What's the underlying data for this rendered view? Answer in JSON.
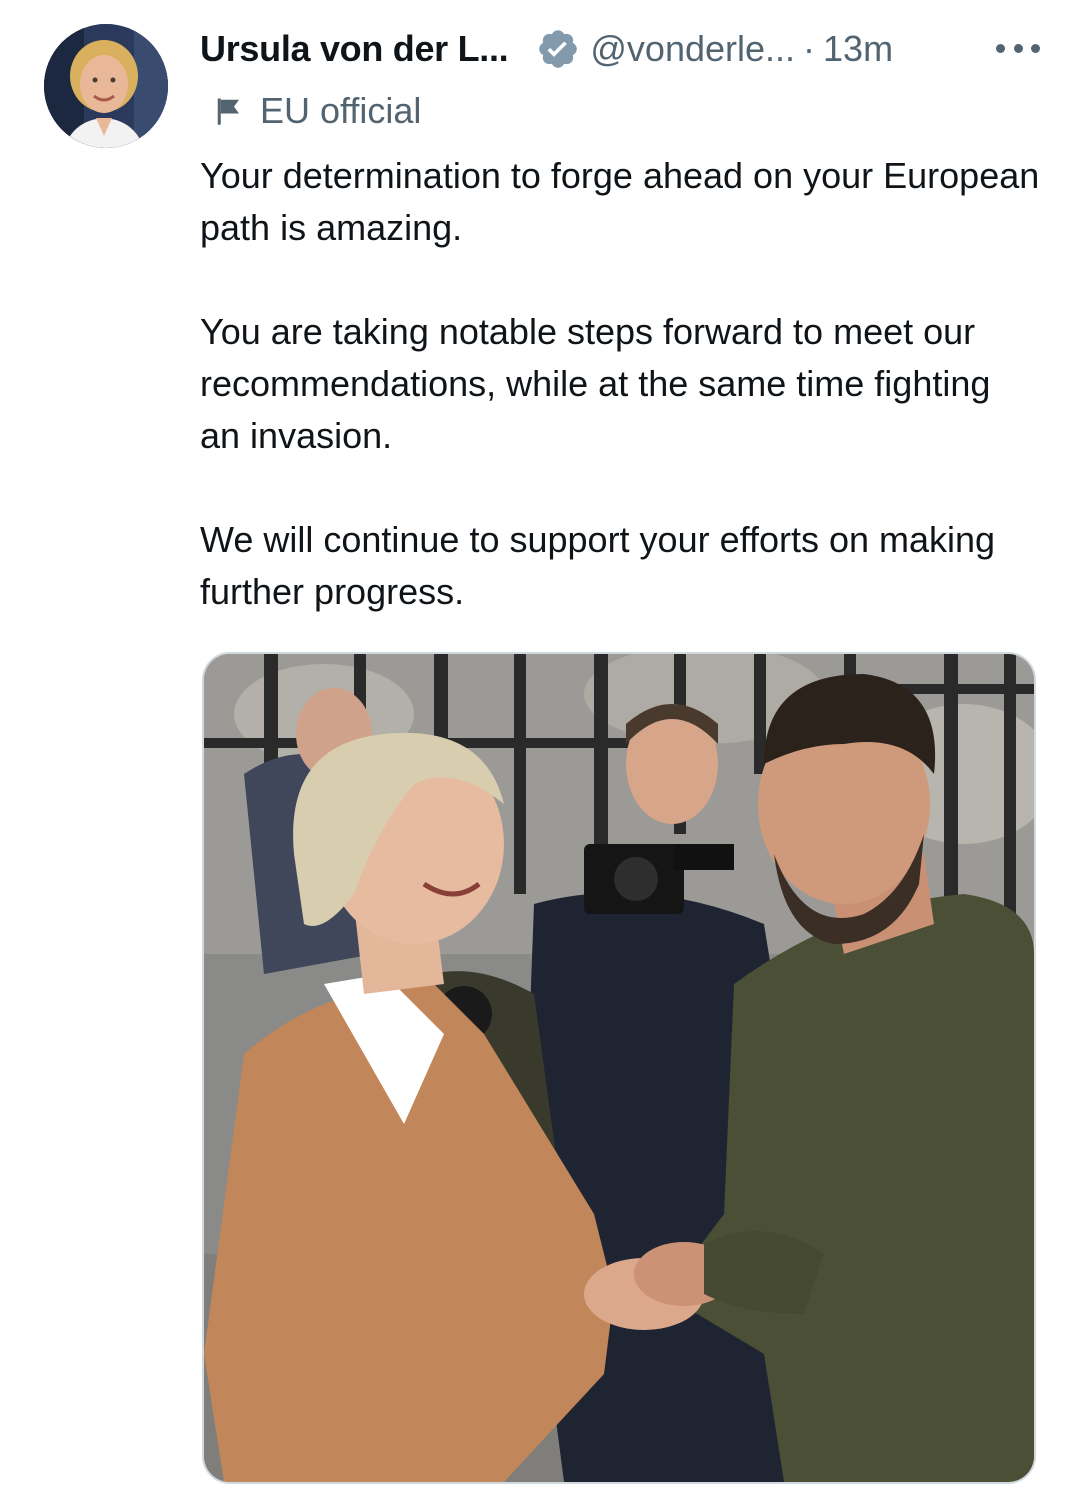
{
  "tweet": {
    "author": {
      "display_name": "Ursula von der L...",
      "handle": "@vonderle...",
      "verified": true,
      "avatar_icon": "profile-photo"
    },
    "separator": "·",
    "time": "13m",
    "more_icon": "more-horizontal-icon",
    "label": {
      "icon": "flag-icon",
      "text": "EU official"
    },
    "paragraphs": [
      "Your determination to forge ahead on your European path is amazing.",
      "You are taking notable steps forward to meet our recommendations, while at the same time fighting an invasion.",
      "We will continue to support your efforts on making further progress."
    ],
    "media": {
      "type": "photo"
    }
  },
  "colors": {
    "text_primary": "#0f1419",
    "text_secondary": "#536471",
    "verified_badge": "#829aab",
    "media_border": "#cfd9de"
  }
}
